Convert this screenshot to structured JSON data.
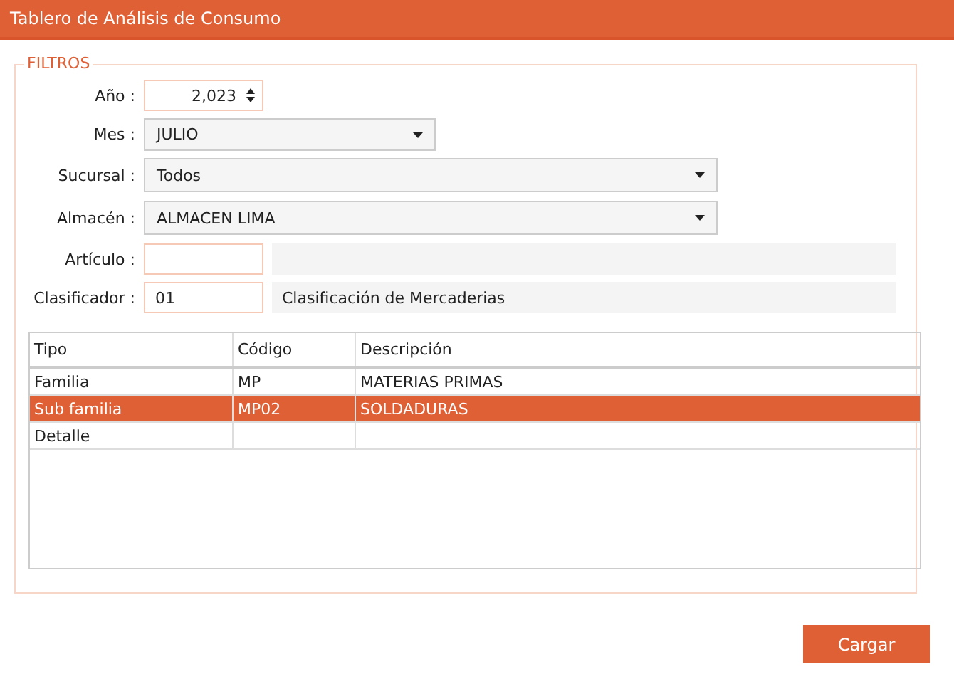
{
  "window": {
    "title": "Tablero de Análisis de Consumo"
  },
  "filters": {
    "legend": "FILTROS",
    "fields": [
      {
        "kind": "spinner",
        "label": "Año :",
        "value": "2,023"
      },
      {
        "kind": "picker",
        "label": "Mes :",
        "value": "JULIO"
      },
      {
        "kind": "dropdown",
        "label": "Sucursal :",
        "value": "Todos"
      },
      {
        "kind": "dropdown",
        "label": "Almacén :",
        "value": "ALMACEN LIMA"
      },
      {
        "kind": "lookup",
        "label": "Artículo :"
      },
      {
        "kind": "lookup",
        "label": "Clasificador :",
        "value": "01",
        "description": "Clasificación de Mercaderias"
      }
    ]
  },
  "table": {
    "columns": [
      "Tipo",
      "Código",
      "Descripción"
    ],
    "rows": [
      {
        "cells": [
          "Familia",
          "MP",
          "MATERIAS PRIMAS"
        ],
        "selected": false
      },
      {
        "cells": [
          "Sub familia",
          "MP02",
          "SOLDADURAS"
        ],
        "selected": true
      },
      {
        "cells": [
          "Detalle",
          "",
          ""
        ],
        "selected": false
      }
    ]
  },
  "buttons": [
    "Cargar"
  ]
}
